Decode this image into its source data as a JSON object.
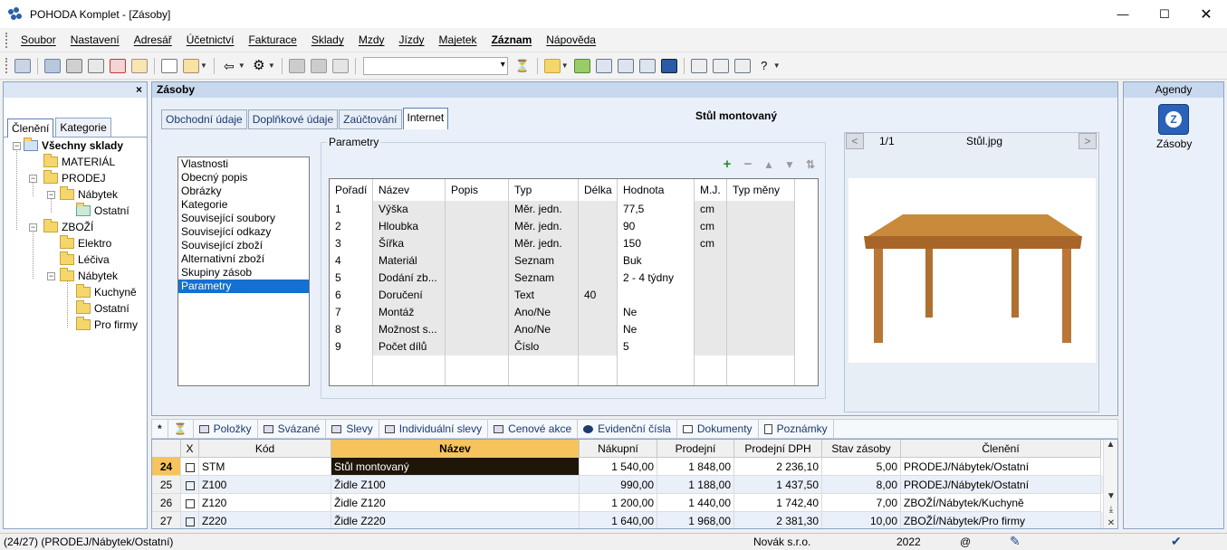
{
  "window": {
    "title": "POHODA Komplet - [Zásoby]"
  },
  "menu": [
    "Soubor",
    "Nastavení",
    "Adresář",
    "Účetnictví",
    "Fakturace",
    "Sklady",
    "Mzdy",
    "Jízdy",
    "Majetek",
    "Záznam",
    "Nápověda"
  ],
  "left_panel": {
    "tabs": [
      "Členění",
      "Kategorie"
    ],
    "tree": [
      "Všechny sklady",
      "MATERIÁL",
      "PRODEJ",
      "Nábytek",
      "Ostatní",
      "ZBOŽÍ",
      "Elektro",
      "Léčiva",
      "Nábytek",
      "Kuchyně",
      "Ostatní",
      "Pro firmy"
    ]
  },
  "main": {
    "title": "Zásoby",
    "tabs": [
      "Obchodní údaje",
      "Doplňkové údaje",
      "Zaúčtování",
      "Internet"
    ],
    "product_name": "Stůl montovaný",
    "image_counter": "1/1",
    "image_file": "Stůl.jpg",
    "list": [
      "Vlastnosti",
      "Obecný popis",
      "Obrázky",
      "Kategorie",
      "Související soubory",
      "Související odkazy",
      "Související zboží",
      "Alternativní zboží",
      "Skupiny zásob",
      "Parametry"
    ],
    "params_label": "Parametry",
    "params_headers": [
      "Pořadí",
      "Název",
      "Popis",
      "Typ",
      "Délka",
      "Hodnota",
      "M.J.",
      "Typ měny"
    ],
    "params_rows": [
      [
        "1",
        "Výška",
        "",
        "Měr. jedn.",
        "",
        "77,5",
        "cm",
        ""
      ],
      [
        "2",
        "Hloubka",
        "",
        "Měr. jedn.",
        "",
        "90",
        "cm",
        ""
      ],
      [
        "3",
        "Šířka",
        "",
        "Měr. jedn.",
        "",
        "150",
        "cm",
        ""
      ],
      [
        "4",
        "Materiál",
        "",
        "Seznam",
        "",
        "Buk",
        "",
        ""
      ],
      [
        "5",
        "Dodání zb...",
        "",
        "Seznam",
        "",
        "2 - 4 týdny",
        "",
        ""
      ],
      [
        "6",
        "Doručení",
        "",
        "Text",
        "40",
        "",
        "",
        ""
      ],
      [
        "7",
        "Montáž",
        "",
        "Ano/Ne",
        "",
        "Ne",
        "",
        ""
      ],
      [
        "8",
        "Možnost s...",
        "",
        "Ano/Ne",
        "",
        "Ne",
        "",
        ""
      ],
      [
        "9",
        "Počet dílů",
        "",
        "Číslo",
        "",
        "5",
        "",
        ""
      ]
    ]
  },
  "agendy": {
    "title": "Agendy",
    "item": "Zásoby"
  },
  "bottom_tabs": [
    "Položky",
    "Svázané",
    "Slevy",
    "Individuální slevy",
    "Cenové akce",
    "Evidenční čísla",
    "Dokumenty",
    "Poznámky"
  ],
  "table": {
    "headers": [
      "X",
      "Kód",
      "Název",
      "Nákupní",
      "Prodejní",
      "Prodejní DPH",
      "Stav zásoby",
      "Členění"
    ],
    "rows": [
      [
        "24",
        "STM",
        "Stůl montovaný",
        "1 540,00",
        "1 848,00",
        "2 236,10",
        "5,00",
        "PRODEJ/Nábytek/Ostatní"
      ],
      [
        "25",
        "Z100",
        "Židle Z100",
        "990,00",
        "1 188,00",
        "1 437,50",
        "8,00",
        "PRODEJ/Nábytek/Ostatní"
      ],
      [
        "26",
        "Z120",
        "Židle Z120",
        "1 200,00",
        "1 440,00",
        "1 742,40",
        "7,00",
        "ZBOŽÍ/Nábytek/Kuchyně"
      ],
      [
        "27",
        "Z220",
        "Židle Z220",
        "1 640,00",
        "1 968,00",
        "2 381,30",
        "10,00",
        "ZBOŽÍ/Nábytek/Pro firmy"
      ]
    ]
  },
  "status": {
    "left": "(24/27) (PRODEJ/Nábytek/Ostatní)",
    "company": "Novák s.r.o.",
    "year": "2022",
    "at": "@"
  }
}
